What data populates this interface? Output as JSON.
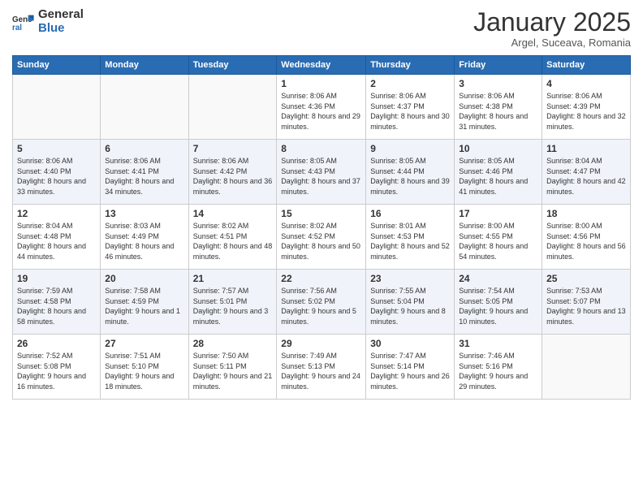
{
  "header": {
    "logo_general": "General",
    "logo_blue": "Blue",
    "month_title": "January 2025",
    "subtitle": "Argel, Suceava, Romania"
  },
  "weekdays": [
    "Sunday",
    "Monday",
    "Tuesday",
    "Wednesday",
    "Thursday",
    "Friday",
    "Saturday"
  ],
  "weeks": [
    [
      {
        "day": "",
        "info": ""
      },
      {
        "day": "",
        "info": ""
      },
      {
        "day": "",
        "info": ""
      },
      {
        "day": "1",
        "info": "Sunrise: 8:06 AM\nSunset: 4:36 PM\nDaylight: 8 hours and 29 minutes."
      },
      {
        "day": "2",
        "info": "Sunrise: 8:06 AM\nSunset: 4:37 PM\nDaylight: 8 hours and 30 minutes."
      },
      {
        "day": "3",
        "info": "Sunrise: 8:06 AM\nSunset: 4:38 PM\nDaylight: 8 hours and 31 minutes."
      },
      {
        "day": "4",
        "info": "Sunrise: 8:06 AM\nSunset: 4:39 PM\nDaylight: 8 hours and 32 minutes."
      }
    ],
    [
      {
        "day": "5",
        "info": "Sunrise: 8:06 AM\nSunset: 4:40 PM\nDaylight: 8 hours and 33 minutes."
      },
      {
        "day": "6",
        "info": "Sunrise: 8:06 AM\nSunset: 4:41 PM\nDaylight: 8 hours and 34 minutes."
      },
      {
        "day": "7",
        "info": "Sunrise: 8:06 AM\nSunset: 4:42 PM\nDaylight: 8 hours and 36 minutes."
      },
      {
        "day": "8",
        "info": "Sunrise: 8:05 AM\nSunset: 4:43 PM\nDaylight: 8 hours and 37 minutes."
      },
      {
        "day": "9",
        "info": "Sunrise: 8:05 AM\nSunset: 4:44 PM\nDaylight: 8 hours and 39 minutes."
      },
      {
        "day": "10",
        "info": "Sunrise: 8:05 AM\nSunset: 4:46 PM\nDaylight: 8 hours and 41 minutes."
      },
      {
        "day": "11",
        "info": "Sunrise: 8:04 AM\nSunset: 4:47 PM\nDaylight: 8 hours and 42 minutes."
      }
    ],
    [
      {
        "day": "12",
        "info": "Sunrise: 8:04 AM\nSunset: 4:48 PM\nDaylight: 8 hours and 44 minutes."
      },
      {
        "day": "13",
        "info": "Sunrise: 8:03 AM\nSunset: 4:49 PM\nDaylight: 8 hours and 46 minutes."
      },
      {
        "day": "14",
        "info": "Sunrise: 8:02 AM\nSunset: 4:51 PM\nDaylight: 8 hours and 48 minutes."
      },
      {
        "day": "15",
        "info": "Sunrise: 8:02 AM\nSunset: 4:52 PM\nDaylight: 8 hours and 50 minutes."
      },
      {
        "day": "16",
        "info": "Sunrise: 8:01 AM\nSunset: 4:53 PM\nDaylight: 8 hours and 52 minutes."
      },
      {
        "day": "17",
        "info": "Sunrise: 8:00 AM\nSunset: 4:55 PM\nDaylight: 8 hours and 54 minutes."
      },
      {
        "day": "18",
        "info": "Sunrise: 8:00 AM\nSunset: 4:56 PM\nDaylight: 8 hours and 56 minutes."
      }
    ],
    [
      {
        "day": "19",
        "info": "Sunrise: 7:59 AM\nSunset: 4:58 PM\nDaylight: 8 hours and 58 minutes."
      },
      {
        "day": "20",
        "info": "Sunrise: 7:58 AM\nSunset: 4:59 PM\nDaylight: 9 hours and 1 minute."
      },
      {
        "day": "21",
        "info": "Sunrise: 7:57 AM\nSunset: 5:01 PM\nDaylight: 9 hours and 3 minutes."
      },
      {
        "day": "22",
        "info": "Sunrise: 7:56 AM\nSunset: 5:02 PM\nDaylight: 9 hours and 5 minutes."
      },
      {
        "day": "23",
        "info": "Sunrise: 7:55 AM\nSunset: 5:04 PM\nDaylight: 9 hours and 8 minutes."
      },
      {
        "day": "24",
        "info": "Sunrise: 7:54 AM\nSunset: 5:05 PM\nDaylight: 9 hours and 10 minutes."
      },
      {
        "day": "25",
        "info": "Sunrise: 7:53 AM\nSunset: 5:07 PM\nDaylight: 9 hours and 13 minutes."
      }
    ],
    [
      {
        "day": "26",
        "info": "Sunrise: 7:52 AM\nSunset: 5:08 PM\nDaylight: 9 hours and 16 minutes."
      },
      {
        "day": "27",
        "info": "Sunrise: 7:51 AM\nSunset: 5:10 PM\nDaylight: 9 hours and 18 minutes."
      },
      {
        "day": "28",
        "info": "Sunrise: 7:50 AM\nSunset: 5:11 PM\nDaylight: 9 hours and 21 minutes."
      },
      {
        "day": "29",
        "info": "Sunrise: 7:49 AM\nSunset: 5:13 PM\nDaylight: 9 hours and 24 minutes."
      },
      {
        "day": "30",
        "info": "Sunrise: 7:47 AM\nSunset: 5:14 PM\nDaylight: 9 hours and 26 minutes."
      },
      {
        "day": "31",
        "info": "Sunrise: 7:46 AM\nSunset: 5:16 PM\nDaylight: 9 hours and 29 minutes."
      },
      {
        "day": "",
        "info": ""
      }
    ]
  ]
}
